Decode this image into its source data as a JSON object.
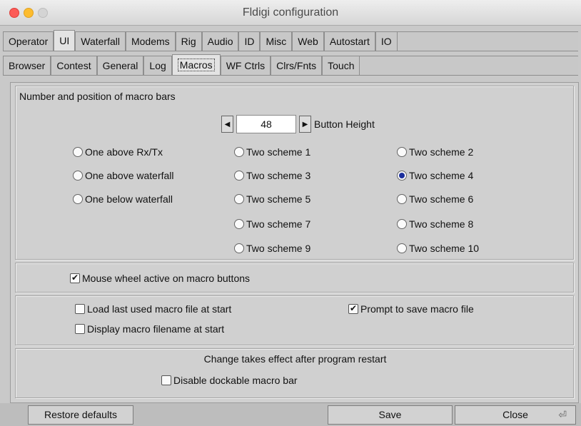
{
  "window": {
    "title": "Fldigi configuration"
  },
  "tabs_main": [
    "Operator",
    "UI",
    "Waterfall",
    "Modems",
    "Rig",
    "Audio",
    "ID",
    "Misc",
    "Web",
    "Autostart",
    "IO"
  ],
  "tabs_sub": [
    "Browser",
    "Contest",
    "General",
    "Log",
    "Macros",
    "WF Ctrls",
    "Clrs/Fnts",
    "Touch"
  ],
  "macro_bars": {
    "group_label": "Number and position of macro bars",
    "button_height": {
      "value": "48",
      "label": "Button Height"
    },
    "options": [
      {
        "label": "One above Rx/Tx",
        "selected": false
      },
      {
        "label": "One above waterfall",
        "selected": false
      },
      {
        "label": "One below waterfall",
        "selected": false
      },
      {
        "label": "Two scheme 1",
        "selected": false
      },
      {
        "label": "Two scheme 3",
        "selected": false
      },
      {
        "label": "Two scheme 5",
        "selected": false
      },
      {
        "label": "Two scheme 7",
        "selected": false
      },
      {
        "label": "Two scheme 9",
        "selected": false
      },
      {
        "label": "Two scheme 2",
        "selected": false
      },
      {
        "label": "Two scheme 4",
        "selected": true
      },
      {
        "label": "Two scheme 6",
        "selected": false
      },
      {
        "label": "Two scheme 8",
        "selected": false
      },
      {
        "label": "Two scheme 10",
        "selected": false
      }
    ]
  },
  "mouse_wheel": {
    "label": "Mouse wheel active on macro buttons",
    "checked": true
  },
  "macro_file": {
    "load_last": {
      "label": "Load last used macro file at start",
      "checked": false
    },
    "prompt_save": {
      "label": "Prompt to save macro file",
      "checked": true
    },
    "display_filename": {
      "label": "Display macro filename at start",
      "checked": false
    }
  },
  "dockable": {
    "note": "Change takes effect after program restart",
    "disable": {
      "label": "Disable dockable macro bar",
      "checked": false
    }
  },
  "buttons": {
    "restore": "Restore defaults",
    "save": "Save",
    "close": "Close",
    "close_glyph": "⏎"
  }
}
